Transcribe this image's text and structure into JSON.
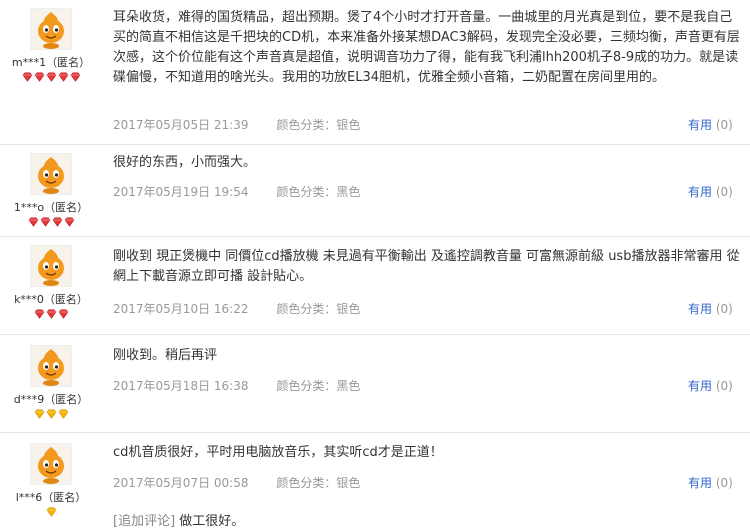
{
  "reviews": [
    {
      "username": "m***1（匿名）",
      "gem_count": 5,
      "gem_type": "red",
      "text": "耳朵收货，难得的国货精品，超出预期。煲了4个小时才打开音量。一曲城里的月光真是到位，要不是我自己买的简直不相信这是千把块的CD机，本来准备外接某想DAC3解码，发现完全没必要，三频均衡，声音更有层次感，这个价位能有这个声音真是超值，说明调音功力了得，能有我飞利浦lhh200机子8-9成的功力。就是读碟偏慢，不知道用的啥光头。我用的功放EL34胆机，优雅全频小音箱，二奶配置在房间里用的。",
      "date": "2017年05月05日 21:39",
      "color": "颜色分类：银色",
      "helpful_label": "有用",
      "helpful_count": "(0)"
    },
    {
      "username": "1***o（匿名）",
      "gem_count": 4,
      "gem_type": "red",
      "text": "很好的东西，小而强大。",
      "date": "2017年05月19日 19:54",
      "color": "颜色分类：黑色",
      "helpful_label": "有用",
      "helpful_count": "(0)"
    },
    {
      "username": "k***0（匿名）",
      "gem_count": 3,
      "gem_type": "red",
      "text": "剛收到 現正煲機中 同價位cd播放機 未見過有平衡輸出 及遙控調教音量 可富無源前級 usb播放器非常審用 從網上下載音源立即可播 設計貼心。",
      "date": "2017年05月10日 16:22",
      "color": "颜色分类：银色",
      "helpful_label": "有用",
      "helpful_count": "(0)"
    },
    {
      "username": "d***9（匿名）",
      "gem_count": 3,
      "gem_type": "gold",
      "text": "刚收到。稍后再评",
      "date": "2017年05月18日 16:38",
      "color": "颜色分类：黑色",
      "helpful_label": "有用",
      "helpful_count": "(0)"
    },
    {
      "username": "l***6（匿名）",
      "gem_count": 1,
      "gem_type": "gold",
      "text": "cd机音质很好，平时用电脑放音乐，其实听cd才是正道！",
      "date": "2017年05月07日 00:58",
      "color": "颜色分类：银色",
      "helpful_label": "有用",
      "helpful_count": "(0)",
      "append_tag": "[追加评论]",
      "append_text": "做工很好。"
    }
  ],
  "colors": {
    "link": "#3366cc",
    "meta": "#999999",
    "gem_red": "#e4393c",
    "gem_gold": "#f7b500",
    "avatar": "#f39a1e"
  }
}
